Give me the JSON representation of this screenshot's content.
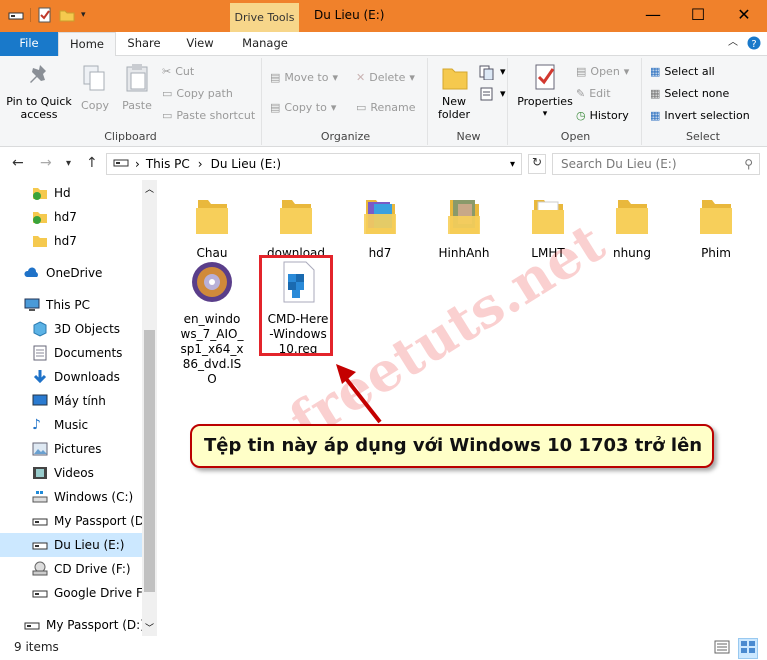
{
  "window": {
    "title": "Du Lieu (E:)",
    "context_tab": "Drive Tools",
    "controls": [
      "minimize-icon",
      "maximize-icon",
      "close-icon"
    ]
  },
  "menu": {
    "file": "File",
    "home": "Home",
    "share": "Share",
    "view": "View",
    "manage": "Manage"
  },
  "ribbon": {
    "clipboard": {
      "label": "Clipboard",
      "pin": "Pin to Quick access",
      "copy": "Copy",
      "paste": "Paste",
      "cut": "Cut",
      "copy_path": "Copy path",
      "paste_shortcut": "Paste shortcut"
    },
    "organize": {
      "label": "Organize",
      "move_to": "Move to",
      "copy_to": "Copy to",
      "delete": "Delete",
      "rename": "Rename"
    },
    "new": {
      "label": "New",
      "new_folder": "New folder"
    },
    "open": {
      "label": "Open",
      "properties": "Properties",
      "open": "Open",
      "edit": "Edit",
      "history": "History"
    },
    "select": {
      "label": "Select",
      "select_all": "Select all",
      "select_none": "Select none",
      "invert": "Invert selection"
    }
  },
  "address": {
    "this_pc": "This PC",
    "drive": "Du Lieu (E:)",
    "search_placeholder": "Search Du Lieu (E:)"
  },
  "nav": {
    "hd": "Hd",
    "hd7a": "hd7",
    "hd7b": "hd7",
    "onedrive": "OneDrive",
    "thispc": "This PC",
    "objects": "3D Objects",
    "documents": "Documents",
    "downloads": "Downloads",
    "maytinh": "Máy tính",
    "music": "Music",
    "pictures": "Pictures",
    "videos": "Videos",
    "windows": "Windows (C:)",
    "passport_d": "My Passport (D:)",
    "dulieu": "Du Lieu (E:)",
    "cd": "CD Drive (F:)",
    "gdrive": "Google Drive File",
    "passport2": "My Passport (D:)"
  },
  "files": {
    "chau": "Chau",
    "download": "download",
    "hd7": "hd7",
    "hinhanh": "HinhAnh",
    "lmht": "LMHT",
    "nhung": "nhung",
    "phim": "Phim",
    "iso": "en_windows_7_AIO_sp1_x64_x86_dvd.ISO",
    "reg": "CMD-Here-Windows10.reg"
  },
  "status": {
    "count": "9 items"
  },
  "annotation": {
    "callout": "Tệp tin này áp dụng với Windows 10 1703 trở lên",
    "watermark": "freetuts.net"
  },
  "colors": {
    "titlebar": "#f0812b",
    "file_tab": "#1979ca",
    "context_tab": "#f7d68a",
    "selection": "#cce8ff",
    "highlight": "#e3242b",
    "folder": "#f5c94e"
  }
}
